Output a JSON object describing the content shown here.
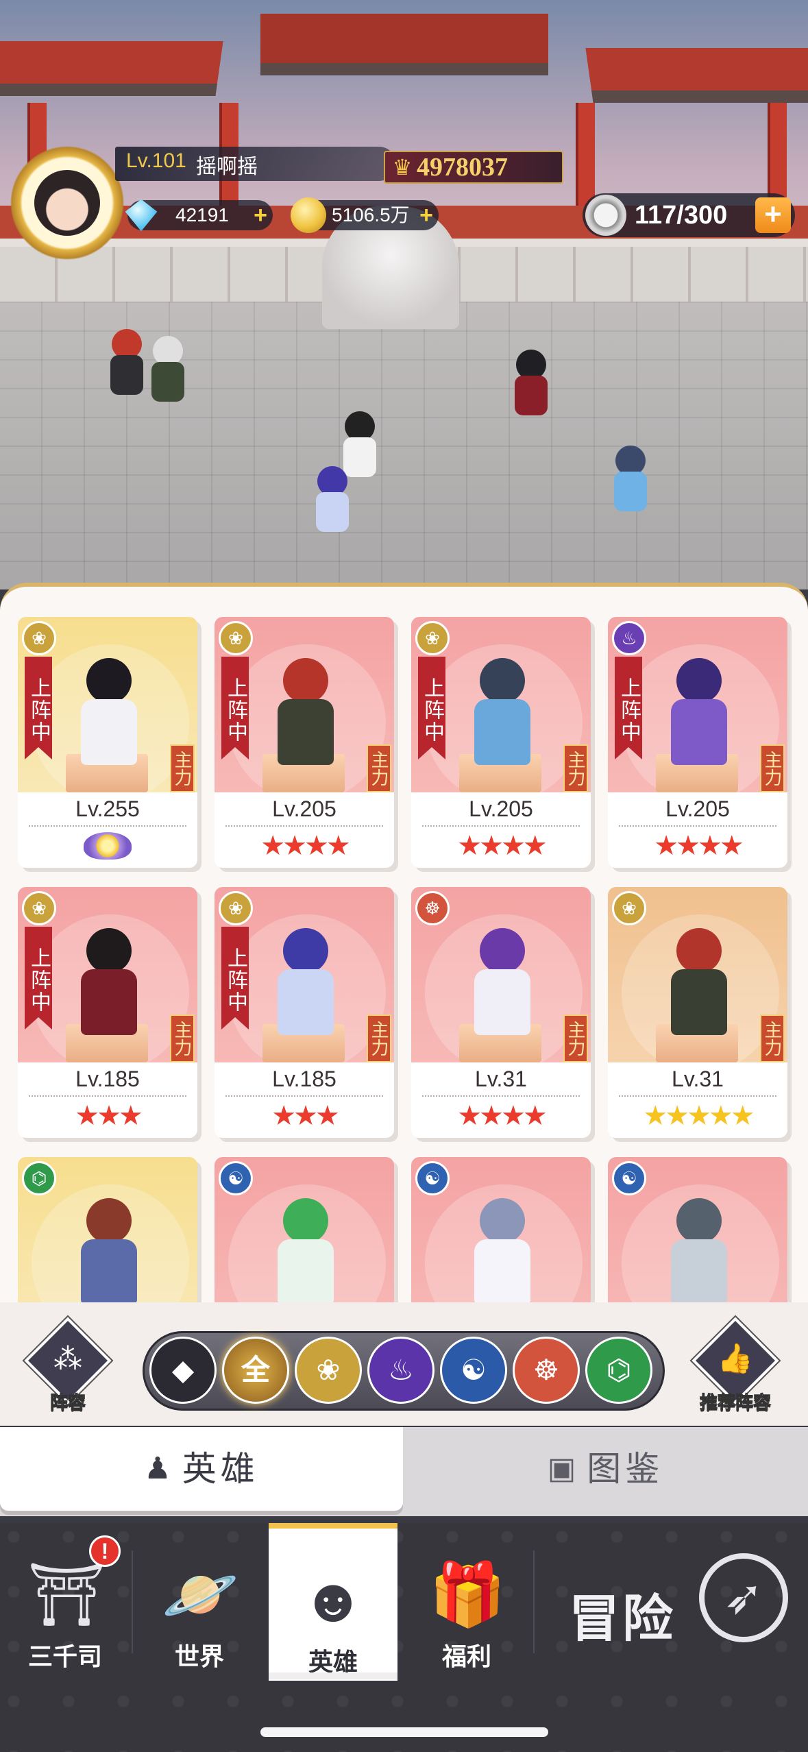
{
  "player": {
    "level": "Lv.101",
    "name": "摇啊摇",
    "power": "4978037",
    "diamonds": "42191",
    "gold": "5106.5万",
    "stamina": "117/300",
    "plus": "+"
  },
  "heroes": [
    {
      "level": "Lv.255",
      "deployed": "上阵中",
      "main": "主力",
      "faction": "lotus",
      "stars": "",
      "bg": "yellow"
    },
    {
      "level": "Lv.205",
      "deployed": "上阵中",
      "main": "主力",
      "faction": "lotus",
      "stars": "★★★★",
      "bg": "pink"
    },
    {
      "level": "Lv.205",
      "deployed": "上阵中",
      "main": "主力",
      "faction": "lotus",
      "stars": "★★★★",
      "bg": "pink"
    },
    {
      "level": "Lv.205",
      "deployed": "上阵中",
      "main": "主力",
      "faction": "flame",
      "stars": "★★★★",
      "bg": "pink"
    },
    {
      "level": "Lv.185",
      "deployed": "上阵中",
      "main": "主力",
      "faction": "lotus",
      "stars": "★★★",
      "bg": "pink"
    },
    {
      "level": "Lv.185",
      "deployed": "上阵中",
      "main": "主力",
      "faction": "lotus",
      "stars": "★★★",
      "bg": "pink"
    },
    {
      "level": "Lv.31",
      "deployed": "",
      "main": "主力",
      "faction": "monk",
      "stars": "★★★★",
      "bg": "pink"
    },
    {
      "level": "Lv.31",
      "deployed": "",
      "main": "主力",
      "faction": "lotus",
      "stars": "★★★★★",
      "bg": "orange"
    }
  ],
  "filters": {
    "lineup": "阵容",
    "recommend": "推荐阵容",
    "all": "全"
  },
  "tabs": {
    "heroes": "英雄",
    "codex": "图鉴"
  },
  "nav": {
    "sanqiansi": "三千司",
    "world": "世界",
    "heroes": "英雄",
    "welfare": "福利",
    "adventure": "冒险",
    "alert": "!"
  }
}
